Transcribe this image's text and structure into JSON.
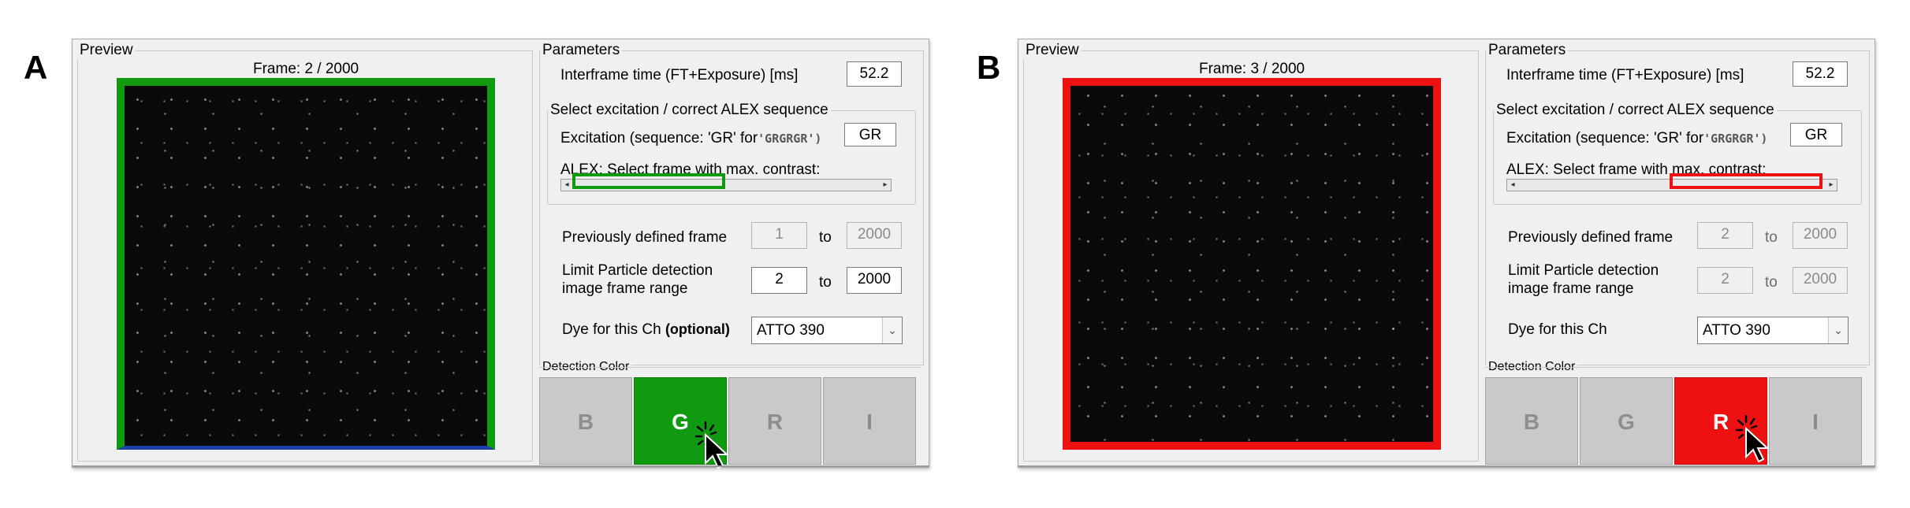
{
  "panels": [
    {
      "label": "A",
      "preview_title": "Preview",
      "frame_label": "Frame: 2 / 2000",
      "frame_color": "#0f9a0f",
      "parameters_title": "Parameters",
      "interframe_label": "Interframe time (FT+Exposure) [ms]",
      "interframe_value": "52.2",
      "alex_group_title": "Select excitation / correct ALEX sequence",
      "excitation_label": "Excitation (sequence: 'GR' for",
      "excitation_example": "'GRGRGR')",
      "excitation_value": "GR",
      "alex_label": "ALEX: Select frame with max. contrast:",
      "alex_thumb_color": "#0f9a0f",
      "alex_position": 0.0,
      "prev_frame_label": "Previously defined frame",
      "prev_from": "1",
      "to1": "to",
      "prev_to": "2000",
      "limit_label_1": "Limit Particle detection",
      "limit_label_2": "image frame range",
      "limit_from": "2",
      "to2": "to",
      "limit_to": "2000",
      "limit_enabled": true,
      "dye_label": "Dye for this Ch",
      "dye_optional": "(optional)",
      "dye_value": "ATTO 390",
      "detection_title": "Detection Color",
      "colors": [
        "B",
        "G",
        "R",
        "I"
      ],
      "active_color_index": 1,
      "active_color_hex": "#0f9a0f"
    },
    {
      "label": "B",
      "preview_title": "Preview",
      "frame_label": "Frame: 3 / 2000",
      "frame_color": "#ee1111",
      "parameters_title": "Parameters",
      "interframe_label": "Interframe time (FT+Exposure) [ms]",
      "interframe_value": "52.2",
      "alex_group_title": "Select excitation / correct ALEX sequence",
      "excitation_label": "Excitation (sequence: 'GR' for",
      "excitation_example": "'GRGRGR')",
      "excitation_value": "GR",
      "alex_label": "ALEX: Select frame with max. contrast:",
      "alex_thumb_color": "#ee1111",
      "alex_position": 1.0,
      "prev_frame_label": "Previously defined frame",
      "prev_from": "2",
      "to1": "to",
      "prev_to": "2000",
      "limit_label_1": "Limit Particle detection",
      "limit_label_2": "image frame range",
      "limit_from": "2",
      "to2": "to",
      "limit_to": "2000",
      "limit_enabled": false,
      "dye_label": "Dye for this Ch",
      "dye_optional": "",
      "dye_value": "ATTO 390",
      "detection_title": "Detection Color",
      "colors": [
        "B",
        "G",
        "R",
        "I"
      ],
      "active_color_index": 2,
      "active_color_hex": "#ee1111"
    }
  ]
}
